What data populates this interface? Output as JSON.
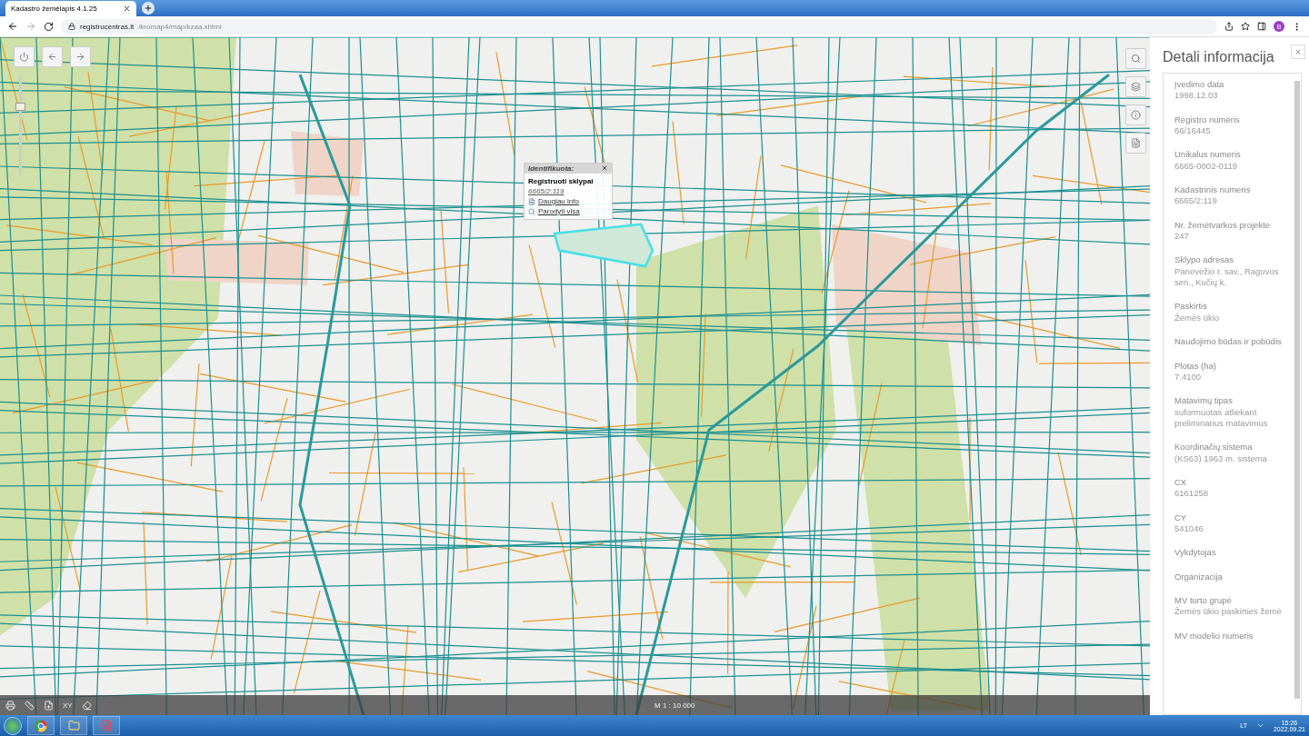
{
  "browser": {
    "tab_title": "Kadastro žemėlapis 4.1.25",
    "url_host": "registrucentras.lt",
    "url_path": "/kromap4/map/kzaa.xhtml",
    "profile_initial": "B"
  },
  "map": {
    "zoom": {
      "level": 0.7
    },
    "popup": {
      "title": "Identifikuota:",
      "heading": "Registruoti sklypai",
      "number": "6665/2:119",
      "links": [
        {
          "kind": "info",
          "label": "Daugiau info"
        },
        {
          "kind": "search",
          "label": "Parodyti visa"
        }
      ]
    },
    "tools": [
      {
        "kind": "search"
      },
      {
        "kind": "layers"
      },
      {
        "kind": "info"
      },
      {
        "kind": "document"
      }
    ],
    "status": {
      "scale": "M 1 : 10 000",
      "xy": "XY"
    }
  },
  "panel": {
    "title": "Detali informacija",
    "close": "×",
    "fields": [
      {
        "label": "Įvedimo data",
        "value": "1998.12.03"
      },
      {
        "label": "Registro numeris",
        "value": "66/16445"
      },
      {
        "label": "Unikalus numeris",
        "value": "6665-0002-0119"
      },
      {
        "label": "Kadastrinis numeris",
        "value": "6665/2:119"
      },
      {
        "label": "Nr. žemėtvarkos projekte",
        "value": "247"
      },
      {
        "label": "Sklypo adresas",
        "value": "Panevėžio r. sav., Raguvos sen., Kučių k."
      },
      {
        "label": "Paskirtis",
        "value": "Žemės ūkio"
      },
      {
        "label": "Naudojimo būdas ir pobūdis"
      },
      {
        "label": "Plotas (ha)",
        "value": "7.4100"
      },
      {
        "label": "Matavimų tipas",
        "value": "suformuotas atliekant preliminarius matavimus"
      },
      {
        "label": "Koordinačių sistema",
        "value": "(KS63) 1963 m. sistema"
      },
      {
        "label": "CX",
        "value": "6161258"
      },
      {
        "label": "CY",
        "value": "541046"
      },
      {
        "label": "Vykdytojas"
      },
      {
        "label": "Organizacija"
      },
      {
        "label": "MV turto grupė",
        "value": "Žemės ūkio paskirties žemė"
      },
      {
        "label": "MV modelio numeris"
      }
    ]
  },
  "taskbar": {
    "language": "LT",
    "time": "15:26",
    "date": "2022.09.21"
  }
}
